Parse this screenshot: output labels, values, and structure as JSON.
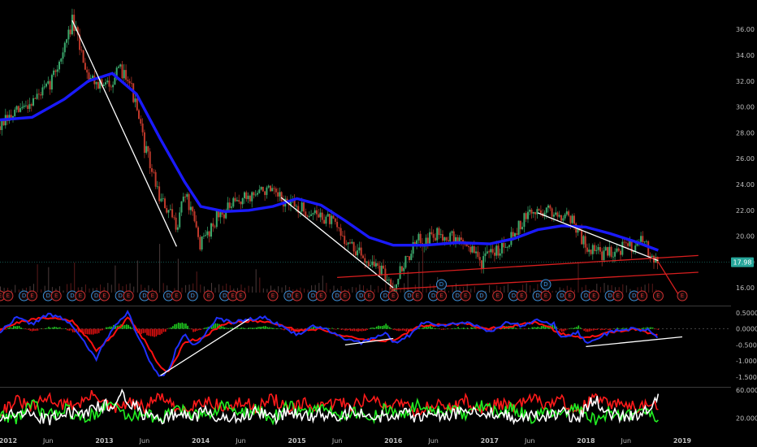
{
  "colors": {
    "background": "#000000",
    "candle_up": "#3aa86b",
    "candle_down": "#c0392b",
    "moving_average": "#1a1aff",
    "trendline": "#ffffff",
    "channel": "#d81e1e",
    "price_tag": "#26a69a",
    "macd_line": "#2030ff",
    "macd_signal": "#ff1010",
    "hist_pos": "#1fd11f",
    "hist_neg": "#e01010",
    "earnings_marker": "#d03030",
    "dividend_marker": "#3a8fd8",
    "osc_red": "#ff1a1a",
    "osc_green": "#22ee22",
    "osc_white": "#ffffff"
  },
  "chart_data": [
    {
      "type": "line",
      "panel": "price",
      "x_labels": [
        "2012",
        "Jun",
        "2013",
        "Jun",
        "2014",
        "Jun",
        "2015",
        "Jun",
        "2016",
        "Jun",
        "2017",
        "Jun",
        "2018",
        "Jun",
        "2019"
      ],
      "x_label_dates": [
        "2012-01",
        "2012-06",
        "2013-01",
        "2013-06",
        "2014-01",
        "2014-06",
        "2015-01",
        "2015-06",
        "2016-01",
        "2016-06",
        "2017-01",
        "2017-06",
        "2018-01",
        "2018-06",
        "2019-01"
      ],
      "y_ticks": [
        "36.00",
        "34.00",
        "32.00",
        "30.00",
        "28.00",
        "26.00",
        "24.00",
        "22.00",
        "20.00",
        "18.00",
        "16.00"
      ],
      "ylim": [
        15.0,
        37.4
      ],
      "last_price": "17.98",
      "price_series": {
        "x": [
          "2011-12",
          "2012-03",
          "2012-06",
          "2012-08",
          "2012-09",
          "2012-11",
          "2013-01",
          "2013-03",
          "2013-04",
          "2013-06",
          "2013-08",
          "2013-10",
          "2013-11",
          "2014-01",
          "2014-03",
          "2014-06",
          "2014-09",
          "2014-11",
          "2015-01",
          "2015-05",
          "2015-08",
          "2015-11",
          "2016-01",
          "2016-02",
          "2016-04",
          "2016-07",
          "2016-10",
          "2016-12",
          "2017-03",
          "2017-06",
          "2017-08",
          "2017-11",
          "2018-01",
          "2018-03",
          "2018-06",
          "2018-08",
          "2018-10"
        ],
        "y": [
          28.5,
          30.0,
          31.5,
          34.5,
          36.6,
          32.5,
          31.5,
          32.8,
          32.5,
          27.0,
          22.8,
          20.8,
          23.5,
          19.3,
          21.5,
          22.8,
          23.6,
          22.8,
          22.2,
          21.3,
          19.0,
          17.6,
          16.1,
          17.5,
          19.6,
          20.2,
          19.5,
          18.0,
          19.5,
          21.8,
          22.0,
          21.6,
          19.2,
          18.6,
          19.2,
          19.5,
          18.1
        ]
      },
      "moving_average": {
        "x": [
          "2011-12",
          "2012-04",
          "2012-08",
          "2012-11",
          "2013-02",
          "2013-05",
          "2013-08",
          "2013-11",
          "2014-01",
          "2014-04",
          "2014-07",
          "2014-10",
          "2015-01",
          "2015-04",
          "2015-07",
          "2015-10",
          "2016-01",
          "2016-05",
          "2016-09",
          "2017-01",
          "2017-04",
          "2017-07",
          "2017-10",
          "2018-01",
          "2018-04",
          "2018-07",
          "2018-10"
        ],
        "y": [
          29.0,
          29.2,
          30.6,
          32.0,
          32.6,
          31.0,
          27.5,
          24.2,
          22.3,
          21.9,
          22.0,
          22.3,
          22.9,
          22.4,
          21.2,
          19.9,
          19.3,
          19.3,
          19.5,
          19.4,
          19.8,
          20.5,
          20.8,
          20.7,
          20.2,
          19.6,
          18.9
        ]
      },
      "trendlines": [
        {
          "x": [
            "2012-09",
            "2013-10"
          ],
          "y": [
            36.7,
            19.2
          ]
        },
        {
          "x": [
            "2014-11",
            "2016-01"
          ],
          "y": [
            23.0,
            16.0
          ]
        },
        {
          "x": [
            "2017-07",
            "2018-10"
          ],
          "y": [
            21.8,
            18.1
          ]
        }
      ],
      "channel_lines": [
        {
          "x": [
            "2015-06",
            "2019-03"
          ],
          "y": [
            16.8,
            18.5
          ]
        },
        {
          "x": [
            "2016-01",
            "2019-03"
          ],
          "y": [
            15.9,
            17.2
          ]
        },
        {
          "x": [
            "2018-10",
            "2019-01"
          ],
          "y": [
            18.0,
            15.0
          ]
        }
      ],
      "events": [
        {
          "x": "2011-12",
          "label": "E"
        },
        {
          "x": "2012-01",
          "label": "E"
        },
        {
          "x": "2012-03",
          "label": "D"
        },
        {
          "x": "2012-04",
          "label": "E"
        },
        {
          "x": "2012-06",
          "label": "D"
        },
        {
          "x": "2012-07",
          "label": "E"
        },
        {
          "x": "2012-09",
          "label": "D"
        },
        {
          "x": "2012-10",
          "label": "E"
        },
        {
          "x": "2012-12",
          "label": "D"
        },
        {
          "x": "2013-01",
          "label": "E"
        },
        {
          "x": "2013-03",
          "label": "D"
        },
        {
          "x": "2013-04",
          "label": "E"
        },
        {
          "x": "2013-06",
          "label": "D"
        },
        {
          "x": "2013-07",
          "label": "E"
        },
        {
          "x": "2013-09",
          "label": "D"
        },
        {
          "x": "2013-10",
          "label": "E"
        },
        {
          "x": "2013-12",
          "label": "D"
        },
        {
          "x": "2014-02",
          "label": "E"
        },
        {
          "x": "2014-04",
          "label": "D"
        },
        {
          "x": "2014-05",
          "label": "E"
        },
        {
          "x": "2014-06",
          "label": "E"
        },
        {
          "x": "2014-10",
          "label": "E"
        },
        {
          "x": "2014-12",
          "label": "D"
        },
        {
          "x": "2015-01",
          "label": "E"
        },
        {
          "x": "2015-03",
          "label": "D"
        },
        {
          "x": "2015-04",
          "label": "E"
        },
        {
          "x": "2015-06",
          "label": "D"
        },
        {
          "x": "2015-07",
          "label": "E"
        },
        {
          "x": "2015-09",
          "label": "D"
        },
        {
          "x": "2015-10",
          "label": "E"
        },
        {
          "x": "2015-12",
          "label": "D"
        },
        {
          "x": "2016-01",
          "label": "E"
        },
        {
          "x": "2016-03",
          "label": "D"
        },
        {
          "x": "2016-04",
          "label": "E"
        },
        {
          "x": "2016-06",
          "label": "D"
        },
        {
          "x": "2016-07",
          "label": "E"
        },
        {
          "x": "2016-09",
          "label": "D"
        },
        {
          "x": "2016-10",
          "label": "E"
        },
        {
          "x": "2016-12",
          "label": "D"
        },
        {
          "x": "2017-02",
          "label": "E"
        },
        {
          "x": "2017-04",
          "label": "D"
        },
        {
          "x": "2017-05",
          "label": "E"
        },
        {
          "x": "2017-07",
          "label": "D"
        },
        {
          "x": "2017-08",
          "label": "E"
        },
        {
          "x": "2017-10",
          "label": "D"
        },
        {
          "x": "2017-11",
          "label": "E"
        },
        {
          "x": "2018-01",
          "label": "D"
        },
        {
          "x": "2018-02",
          "label": "E"
        },
        {
          "x": "2018-04",
          "label": "D"
        },
        {
          "x": "2018-05",
          "label": "E"
        },
        {
          "x": "2018-07",
          "label": "D"
        },
        {
          "x": "2018-08",
          "label": "E"
        },
        {
          "x": "2018-10",
          "label": "E"
        },
        {
          "x": "2019-01",
          "label": "E"
        }
      ],
      "dividend_markers_above": [
        {
          "x": "2016-07",
          "label": "D"
        },
        {
          "x": "2017-08",
          "label": "D"
        }
      ]
    },
    {
      "type": "line",
      "panel": "macd",
      "y_ticks": [
        "0.5000",
        "0.0000",
        "-0.5000",
        "-1.0000",
        "-1.5000"
      ],
      "ylim": [
        -1.7,
        0.62
      ],
      "macd": {
        "x": [
          "2011-12",
          "2012-02",
          "2012-04",
          "2012-06",
          "2012-08",
          "2012-09",
          "2012-11",
          "2012-12",
          "2013-01",
          "2013-03",
          "2013-04",
          "2013-05",
          "2013-06",
          "2013-07",
          "2013-08",
          "2013-09",
          "2013-10",
          "2013-11",
          "2013-12",
          "2014-01",
          "2014-03",
          "2014-05",
          "2014-07",
          "2014-09",
          "2014-11",
          "2015-01",
          "2015-03",
          "2015-05",
          "2015-07",
          "2015-09",
          "2015-10",
          "2015-12",
          "2016-01",
          "2016-03",
          "2016-05",
          "2016-07",
          "2016-09",
          "2016-11",
          "2017-01",
          "2017-03",
          "2017-05",
          "2017-07",
          "2017-09",
          "2017-10",
          "2017-12",
          "2018-01",
          "2018-03",
          "2018-05",
          "2018-07",
          "2018-09",
          "2018-10"
        ],
        "y": [
          -0.1,
          0.35,
          0.15,
          0.45,
          0.3,
          0.1,
          -0.6,
          -0.95,
          -0.4,
          0.3,
          0.55,
          -0.2,
          -0.6,
          -1.2,
          -1.5,
          -1.3,
          -0.6,
          -0.1,
          -0.5,
          -0.35,
          0.3,
          0.2,
          0.3,
          0.35,
          0.1,
          -0.2,
          0.1,
          -0.05,
          -0.3,
          -0.45,
          -0.35,
          -0.1,
          -0.45,
          -0.2,
          0.25,
          0.1,
          0.2,
          0.15,
          -0.1,
          0.2,
          0.1,
          0.3,
          0.15,
          -0.3,
          -0.1,
          -0.45,
          -0.2,
          -0.05,
          0.0,
          -0.05,
          -0.3
        ]
      },
      "signal": {
        "x": [
          "2011-12",
          "2012-03",
          "2012-06",
          "2012-09",
          "2012-11",
          "2012-12",
          "2013-02",
          "2013-04",
          "2013-06",
          "2013-08",
          "2013-09",
          "2013-11",
          "2014-01",
          "2014-04",
          "2014-07",
          "2014-10",
          "2015-01",
          "2015-04",
          "2015-07",
          "2015-10",
          "2016-01",
          "2016-04",
          "2016-07",
          "2016-10",
          "2017-01",
          "2017-04",
          "2017-07",
          "2017-10",
          "2018-01",
          "2018-04",
          "2018-07",
          "2018-10"
        ],
        "y": [
          0.0,
          0.25,
          0.35,
          0.25,
          -0.3,
          -0.7,
          -0.2,
          0.35,
          -0.35,
          -1.2,
          -1.35,
          -0.4,
          -0.3,
          0.15,
          0.25,
          0.2,
          -0.05,
          0.0,
          -0.25,
          -0.35,
          -0.35,
          0.05,
          0.15,
          0.15,
          0.0,
          0.1,
          0.2,
          -0.15,
          -0.3,
          -0.1,
          -0.02,
          -0.2
        ]
      },
      "trendlines": [
        {
          "x": [
            "2013-08",
            "2014-07"
          ],
          "y": [
            -1.45,
            0.3
          ]
        },
        {
          "x": [
            "2015-07",
            "2016-01"
          ],
          "y": [
            -0.5,
            -0.3
          ]
        },
        {
          "x": [
            "2018-01",
            "2019-01"
          ],
          "y": [
            -0.55,
            -0.25
          ]
        }
      ]
    },
    {
      "type": "line",
      "panel": "oscillator",
      "y_ticks": [
        "60.0000",
        "20.0000"
      ],
      "ylim": [
        0,
        60
      ],
      "series": [
        {
          "color_key": "osc_red",
          "x": [
            "2011-12",
            "2012-02",
            "2012-04",
            "2012-06",
            "2012-08",
            "2012-10",
            "2012-12",
            "2013-02",
            "2013-04",
            "2013-06",
            "2013-08",
            "2013-10",
            "2013-12",
            "2014-02",
            "2014-04",
            "2014-06",
            "2014-08",
            "2014-10",
            "2014-12",
            "2015-02",
            "2015-04",
            "2015-06",
            "2015-08",
            "2015-10",
            "2015-12",
            "2016-02",
            "2016-04",
            "2016-06",
            "2016-08",
            "2016-10",
            "2016-12",
            "2017-02",
            "2017-04",
            "2017-06",
            "2017-08",
            "2017-10",
            "2017-12",
            "2018-02",
            "2018-04",
            "2018-06",
            "2018-08",
            "2018-10"
          ],
          "y": [
            30,
            45,
            35,
            50,
            38,
            42,
            55,
            30,
            42,
            35,
            52,
            30,
            40,
            45,
            33,
            42,
            36,
            48,
            32,
            40,
            34,
            44,
            38,
            50,
            35,
            46,
            28,
            40,
            35,
            45,
            30,
            42,
            34,
            48,
            40,
            45,
            30,
            50,
            38,
            42,
            35,
            40
          ]
        },
        {
          "color_key": "osc_green",
          "x": [
            "2011-12",
            "2012-02",
            "2012-04",
            "2012-06",
            "2012-08",
            "2012-10",
            "2012-12",
            "2013-02",
            "2013-04",
            "2013-06",
            "2013-08",
            "2013-10",
            "2013-12",
            "2014-02",
            "2014-04",
            "2014-06",
            "2014-08",
            "2014-10",
            "2014-12",
            "2015-02",
            "2015-04",
            "2015-06",
            "2015-08",
            "2015-10",
            "2015-12",
            "2016-02",
            "2016-04",
            "2016-06",
            "2016-08",
            "2016-10",
            "2016-12",
            "2017-02",
            "2017-04",
            "2017-06",
            "2017-08",
            "2017-10",
            "2017-12",
            "2018-02",
            "2018-04",
            "2018-06",
            "2018-08",
            "2018-10"
          ],
          "y": [
            25,
            20,
            40,
            22,
            35,
            18,
            28,
            42,
            20,
            30,
            15,
            38,
            22,
            28,
            40,
            25,
            32,
            20,
            38,
            26,
            36,
            24,
            30,
            18,
            34,
            22,
            40,
            28,
            32,
            24,
            38,
            26,
            36,
            20,
            28,
            22,
            36,
            18,
            28,
            24,
            30,
            20
          ]
        },
        {
          "color_key": "osc_white",
          "x": [
            "2011-12",
            "2012-02",
            "2012-04",
            "2012-06",
            "2012-08",
            "2012-10",
            "2012-12",
            "2013-02",
            "2013-03",
            "2013-04",
            "2013-06",
            "2013-08",
            "2013-10",
            "2013-12",
            "2014-02",
            "2014-04",
            "2014-06",
            "2014-08",
            "2014-10",
            "2014-12",
            "2015-02",
            "2015-04",
            "2015-06",
            "2015-08",
            "2015-10",
            "2015-12",
            "2016-02",
            "2016-04",
            "2016-06",
            "2016-08",
            "2016-10",
            "2016-12",
            "2017-02",
            "2017-04",
            "2017-06",
            "2017-08",
            "2017-10",
            "2017-12",
            "2018-02",
            "2018-04",
            "2018-06",
            "2018-08",
            "2018-10"
          ],
          "y": [
            20,
            28,
            22,
            18,
            30,
            24,
            35,
            40,
            55,
            45,
            25,
            20,
            26,
            22,
            30,
            18,
            24,
            28,
            20,
            30,
            22,
            26,
            18,
            32,
            20,
            24,
            28,
            20,
            26,
            22,
            34,
            24,
            28,
            20,
            25,
            22,
            28,
            20,
            48,
            28,
            20,
            26,
            52
          ]
        }
      ]
    }
  ]
}
